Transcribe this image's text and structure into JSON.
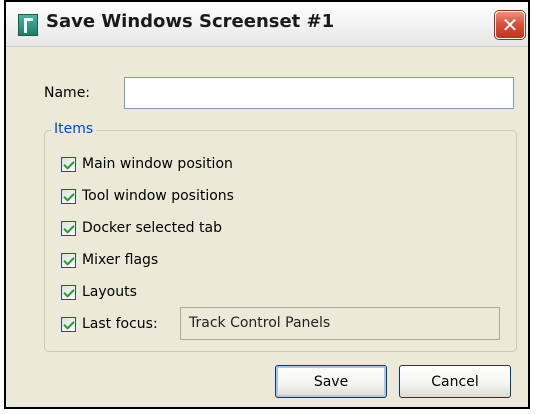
{
  "window": {
    "title": "Save Windows Screenset #1",
    "close_glyph": "✕",
    "app_icon": "reaper-app-icon"
  },
  "name_field": {
    "label": "Name:",
    "value": ""
  },
  "items_group": {
    "legend": "Items",
    "checkboxes": [
      {
        "label": "Main window position",
        "checked": true
      },
      {
        "label": "Tool window positions",
        "checked": true
      },
      {
        "label": "Docker selected tab",
        "checked": true
      },
      {
        "label": "Mixer flags",
        "checked": true
      },
      {
        "label": "Layouts",
        "checked": true
      },
      {
        "label": "Last focus:",
        "checked": true
      }
    ],
    "last_focus_value": "Track Control Panels"
  },
  "buttons": {
    "save": "Save",
    "cancel": "Cancel"
  },
  "colors": {
    "dialog_bg": "#ece9d8",
    "group_legend": "#0046d5",
    "close_button": "#d9523a",
    "check_mark": "#21a121"
  }
}
